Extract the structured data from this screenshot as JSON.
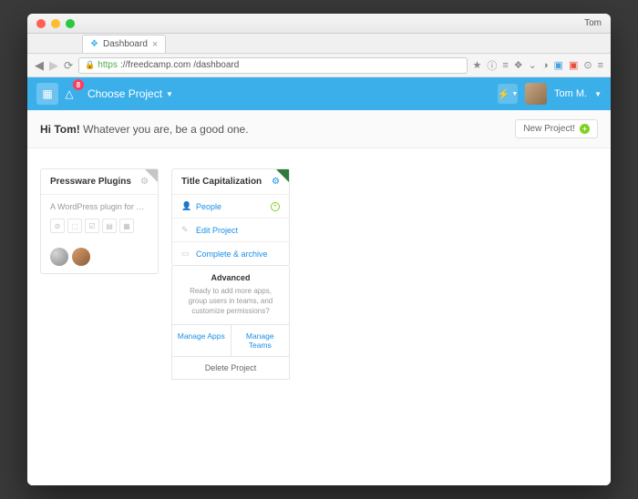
{
  "os": {
    "user": "Tom"
  },
  "browser": {
    "tab_title": "Dashboard",
    "url_secure": "https",
    "url_host": "://freedcamp.com",
    "url_path": "/dashboard"
  },
  "topbar": {
    "notifications": "8",
    "choose_project": "Choose Project",
    "username": "Tom M."
  },
  "greeting": {
    "bold": "Hi Tom!",
    "rest": " Whatever you are, be a good one."
  },
  "new_project_label": "New Project!",
  "cards": {
    "pressware": {
      "title": "Pressware Plugins",
      "desc": "A WordPress plugin for man…"
    },
    "titlecap": {
      "title": "Title Capitalization",
      "menu": {
        "people": "People",
        "edit": "Edit Project",
        "complete": "Complete & archive"
      },
      "advanced": {
        "title": "Advanced",
        "text": "Ready to add more apps, group users in teams, and customize permissions?"
      },
      "manage_apps": "Manage Apps",
      "manage_teams": "Manage Teams",
      "delete": "Delete Project"
    }
  }
}
